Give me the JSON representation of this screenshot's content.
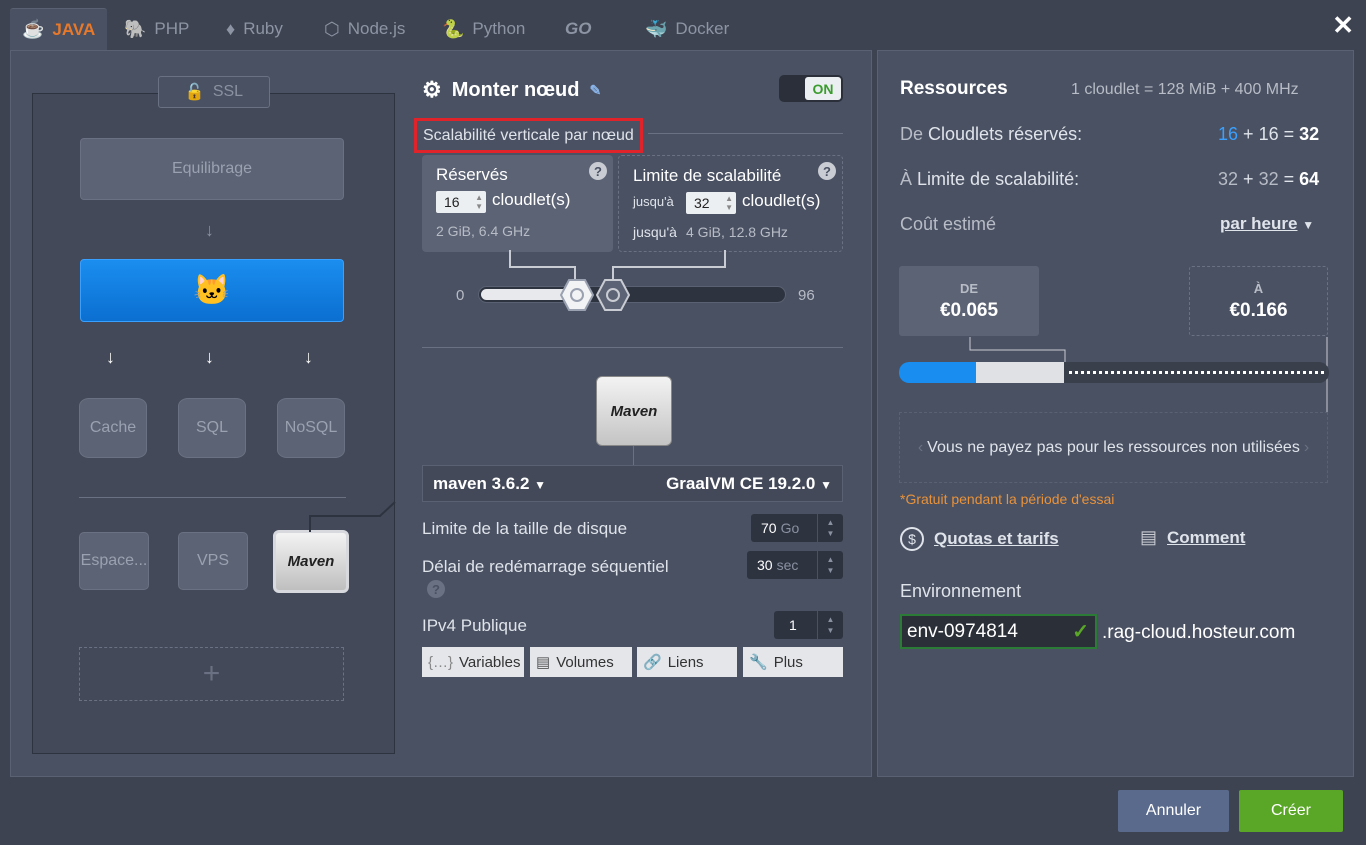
{
  "tabs": [
    {
      "label": "JAVA",
      "icon": "java-icon"
    },
    {
      "label": "PHP",
      "icon": "php-icon"
    },
    {
      "label": "Ruby",
      "icon": "ruby-icon"
    },
    {
      "label": "Node.js",
      "icon": "nodejs-icon"
    },
    {
      "label": "Python",
      "icon": "python-icon"
    },
    {
      "label": "GO",
      "icon": "go-icon"
    },
    {
      "label": "Docker",
      "icon": "docker-icon"
    }
  ],
  "topology": {
    "ssl": "SSL",
    "balancer": "Equilibrage",
    "cache": "Cache",
    "sql": "SQL",
    "nosql": "NoSQL",
    "storage": "Espace...",
    "vps": "VPS",
    "maven": "Maven",
    "add": "+"
  },
  "node": {
    "title": "Monter nœud",
    "toggle": "ON",
    "vertical_scaling_label": "Scalabilité verticale par nœud",
    "reserved": {
      "title": "Réservés",
      "value": "16",
      "unit": "cloudlet(s)",
      "info": "2 GiB, 6.4 GHz"
    },
    "limit": {
      "title": "Limite de scalabilité",
      "prefix": "jusqu'à",
      "value": "32",
      "unit": "cloudlet(s)",
      "info_prefix": "jusqu'à",
      "info": "4 GiB, 12.8 GHz"
    },
    "slider_min": "0",
    "slider_max": "96",
    "help": "?",
    "maven_logo": "Maven",
    "version": "maven 3.6.2",
    "jdk": "GraalVM CE 19.2.0",
    "disk_label": "Limite de la taille de disque",
    "disk_value": "70",
    "disk_unit": "Go",
    "restart_label": "Délai de redémarrage séquentiel",
    "restart_value": "30",
    "restart_unit": "sec",
    "ipv4_label": "IPv4 Publique",
    "ipv4_value": "1",
    "buttons": [
      "Variables",
      "Volumes",
      "Liens",
      "Plus"
    ]
  },
  "resources": {
    "title": "Ressources",
    "cloudlet_def": "1 cloudlet = 128 MiB + 400 MHz",
    "reserved_prefix": "De",
    "reserved_label": "Cloudlets réservés:",
    "reserved_a": "16",
    "reserved_b": "16",
    "reserved_total": "32",
    "limit_prefix": "À",
    "limit_label": "Limite de scalabilité:",
    "limit_a": "32",
    "limit_b": "32",
    "limit_total": "64",
    "plus": "+",
    "equals": "=",
    "cost_label": "Coût estimé",
    "period": "par heure",
    "from_label": "DE",
    "from_price": "€0.065",
    "to_label": "À",
    "to_price": "€0.166",
    "note": "Vous ne payez pas pour les ressources non utilisées",
    "trial": "*Gratuit pendant la période d'essai",
    "quotas": "Quotas et tarifs",
    "how": "Comment",
    "env_label": "Environnement",
    "env_name": "env-0974814",
    "env_domain": ".rag-cloud.hosteur.com"
  },
  "footer": {
    "cancel": "Annuler",
    "create": "Créer"
  },
  "colors": {
    "accent": "#e8792b",
    "primary": "#1a8ef0",
    "success": "#5aa727",
    "danger": "#e0222b"
  }
}
